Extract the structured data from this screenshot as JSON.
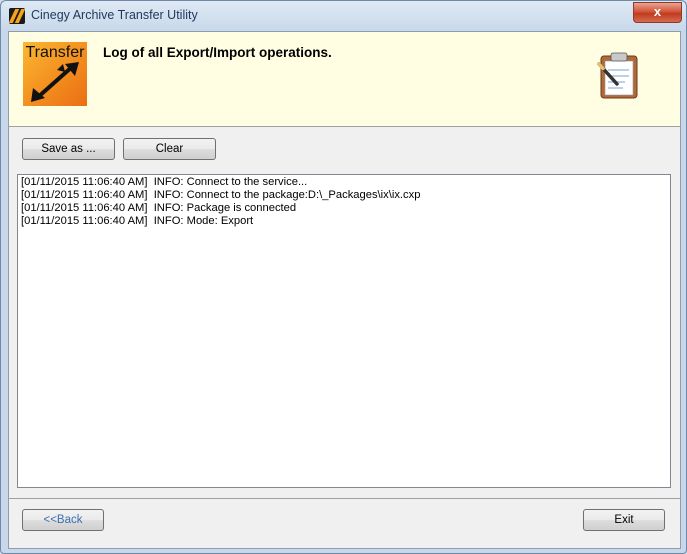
{
  "window": {
    "title": "Cinegy Archive Transfer Utility",
    "close_label": "x"
  },
  "header": {
    "logo_text": "Transfer",
    "title": "Log of all Export/Import operations."
  },
  "toolbar": {
    "save_as_label": "Save as ...",
    "clear_label": "Clear"
  },
  "log": {
    "lines": [
      "[01/11/2015 11:06:40 AM]  INFO: Connect to the service...",
      "[01/11/2015 11:06:40 AM]  INFO: Connect to the package:D:\\_Packages\\ix\\ix.cxp",
      "[01/11/2015 11:06:40 AM]  INFO: Package is connected",
      "[01/11/2015 11:06:40 AM]  INFO: Mode: Export"
    ]
  },
  "footer": {
    "back_label": "<<Back",
    "exit_label": "Exit"
  },
  "icons": {
    "app": "cinegy-app-icon",
    "logo": "transfer-arrows-icon",
    "clipboard": "clipboard-pencil-icon"
  }
}
